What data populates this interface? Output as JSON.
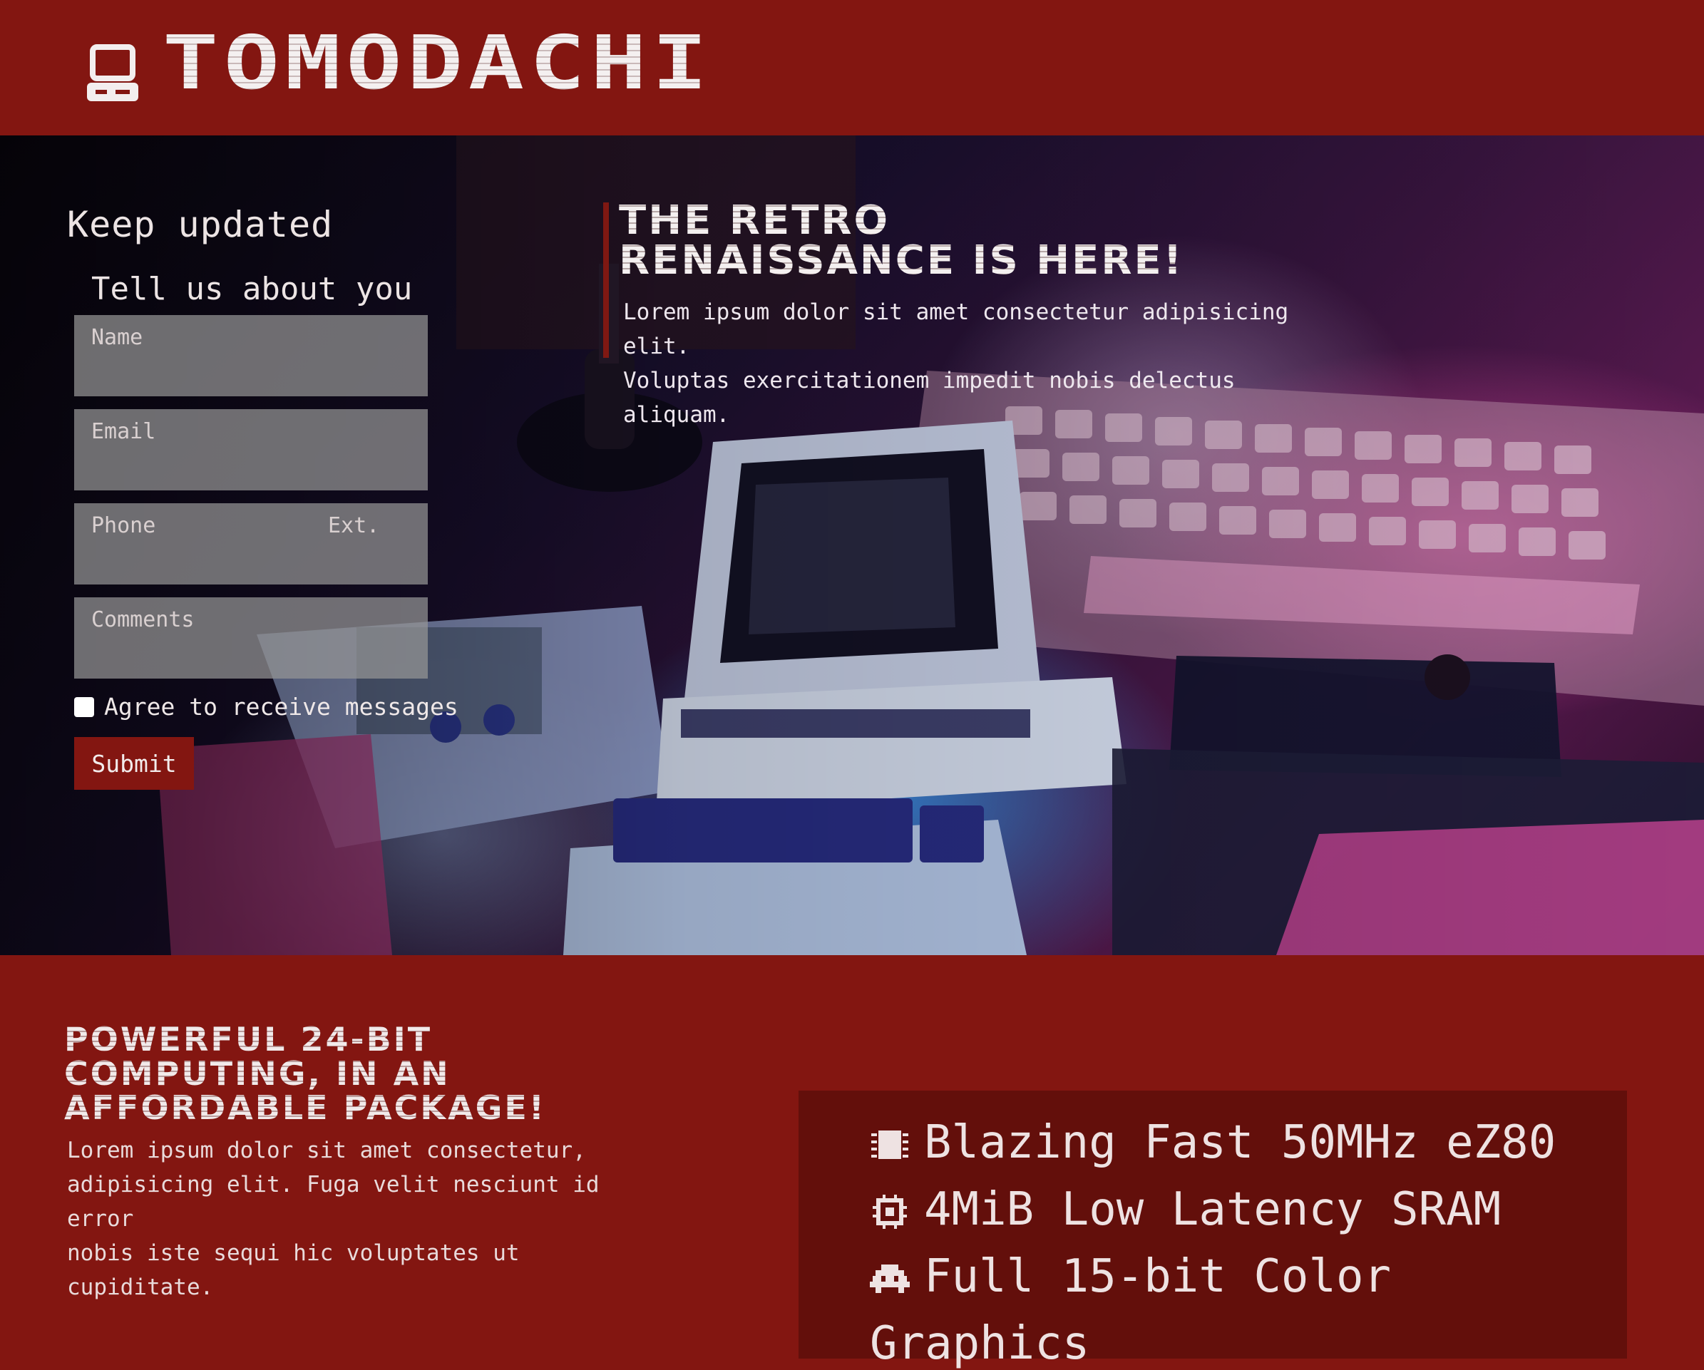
{
  "brand": {
    "name": "TOMODACHI",
    "icon": "retro-computer-icon"
  },
  "form": {
    "title": "Keep updated",
    "subtitle": "Tell us about you",
    "name_placeholder": "Name",
    "email_placeholder": "Email",
    "phone_placeholder": "Phone",
    "ext_placeholder": "Ext.",
    "comments_placeholder": "Comments",
    "agree_label": "Agree to receive messages",
    "agree_checked": false,
    "submit_label": "Submit"
  },
  "hero": {
    "headline_line1": "THE RETRO",
    "headline_line2": "RENAISSANCE IS HERE!",
    "text_line1": "Lorem ipsum dolor sit amet consectetur adipisicing elit.",
    "text_line2": "Voluptas exercitationem impedit nobis delectus aliquam."
  },
  "features": {
    "title_line1": "POWERFUL 24-BIT",
    "title_line2": "COMPUTING, IN AN",
    "title_line3": "AFFORDABLE PACKAGE!",
    "text_line1": "Lorem ipsum dolor sit amet consectetur,",
    "text_line2": "adipisicing elit. Fuga velit nesciunt id error",
    "text_line3": "nobis iste sequi hic voluptates ut cupiditate.",
    "specs": [
      {
        "icon": "chip-icon",
        "label": "Blazing Fast 50MHz eZ80"
      },
      {
        "icon": "memory-icon",
        "label": "4MiB Low Latency SRAM"
      },
      {
        "icon": "space-invader-icon",
        "label": "Full 15-bit Color"
      },
      {
        "icon": "",
        "label": "Graphics"
      }
    ]
  },
  "colors": {
    "brand_red": "#831611",
    "panel_dark_red": "#630f0b",
    "text_light": "#ece6e6"
  }
}
